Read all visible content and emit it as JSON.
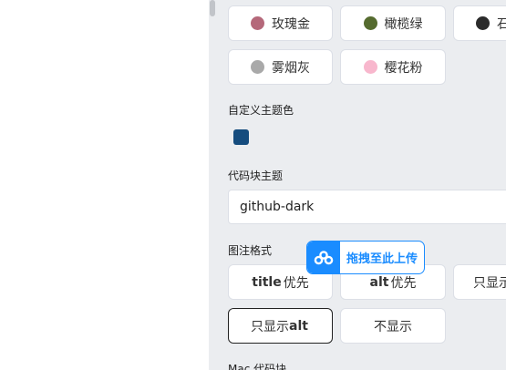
{
  "theme_colors": [
    {
      "label": "玫瑰金",
      "color": "#b5687a"
    },
    {
      "label": "橄榄绿",
      "color": "#556b2f"
    },
    {
      "label": "石",
      "color": "#2b2b2b"
    },
    {
      "label": "雾烟灰",
      "color": "#a9a9a9"
    },
    {
      "label": "樱花粉",
      "color": "#f8b7cd"
    }
  ],
  "custom_theme": {
    "label": "自定义主题色",
    "color": "#154c7e"
  },
  "code_theme": {
    "label": "代码块主题",
    "value": "github-dark"
  },
  "caption_format": {
    "label": "图注格式",
    "options": [
      {
        "bold": "title",
        "rest": "优先"
      },
      {
        "bold": "alt",
        "rest": "优先"
      },
      {
        "bold": "",
        "rest": "只显示"
      },
      {
        "bold": "alt",
        "rest": "只显示 ",
        "bold_after": true
      },
      {
        "bold": "",
        "rest": "不显示"
      }
    ]
  },
  "mac_code_block": {
    "label": "Mac 代码块"
  },
  "upload_badge": {
    "text": "拖拽至此上传",
    "icon": "baidu-cloud-icon"
  }
}
